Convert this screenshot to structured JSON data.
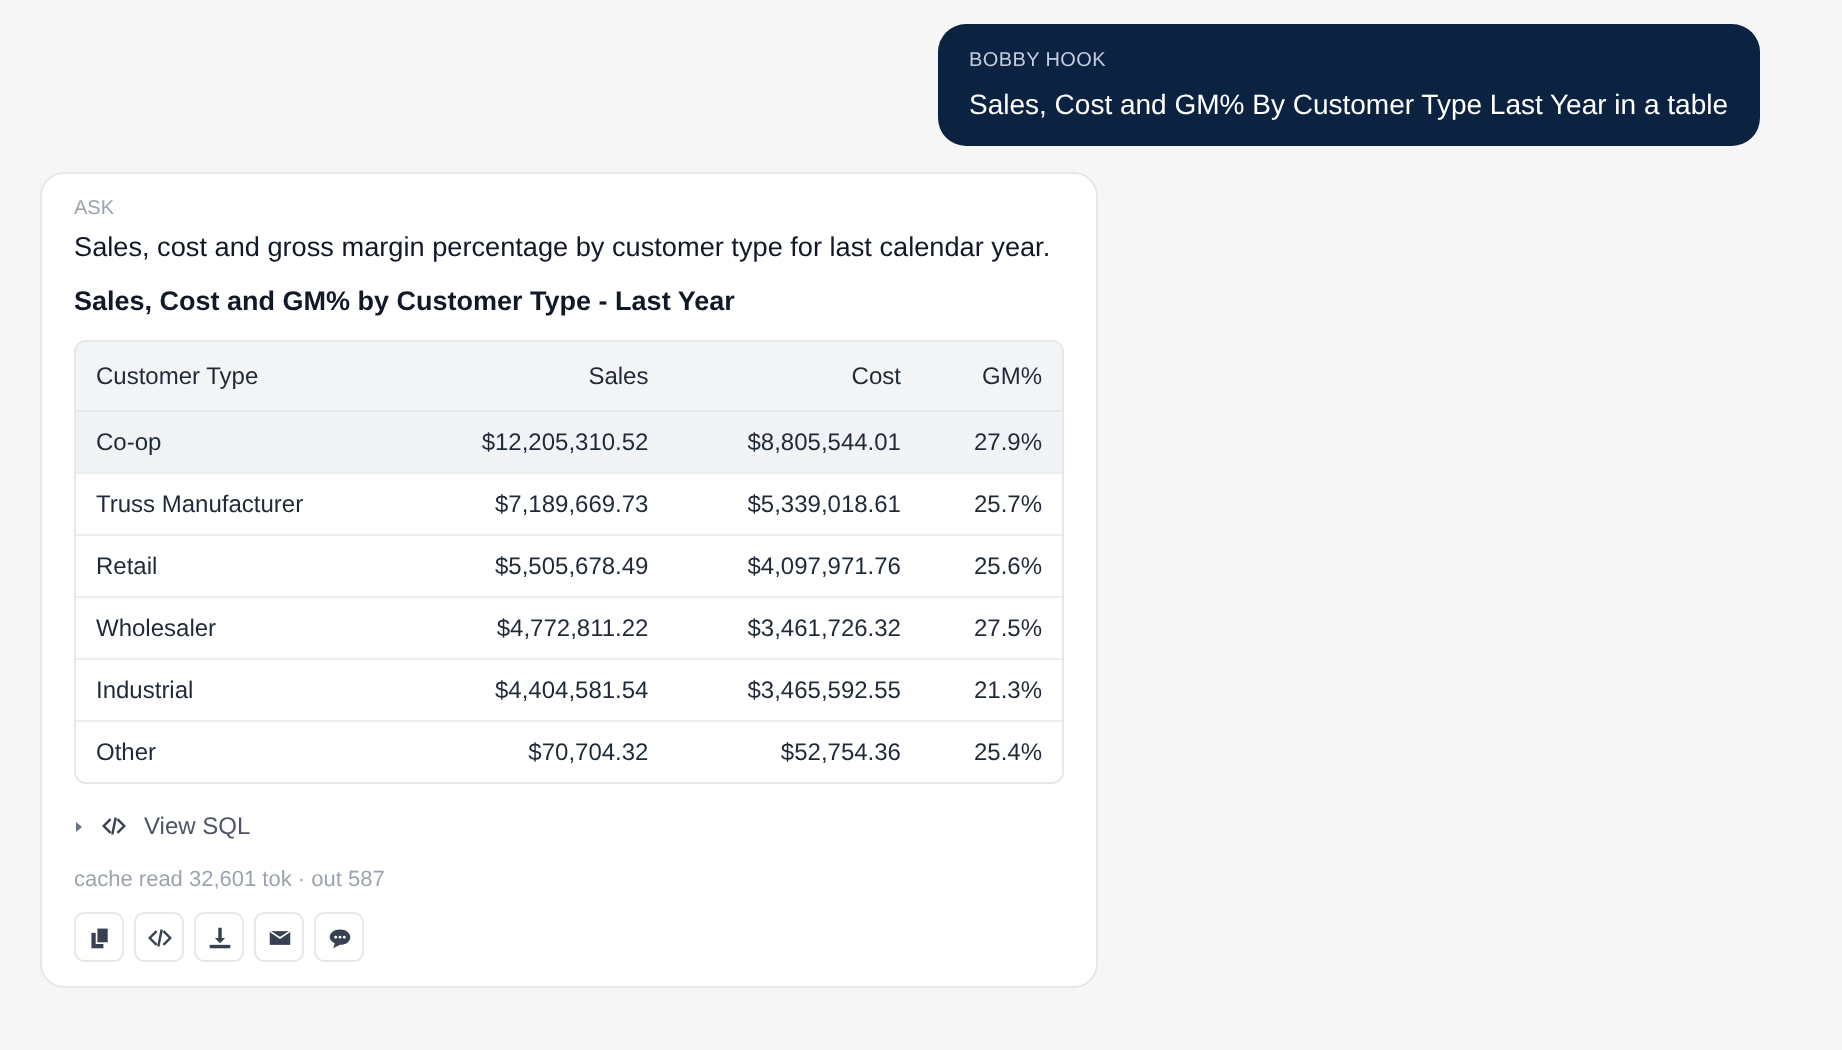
{
  "user_message": {
    "author": "BOBBY HOOK",
    "text": "Sales, Cost and GM% By Customer Type Last Year in a table"
  },
  "answer": {
    "label": "ASK",
    "question": "Sales, cost and gross margin percentage by customer type for last calendar year.",
    "table_title": "Sales, Cost and GM% by Customer Type - Last Year",
    "table": {
      "columns": [
        "Customer Type",
        "Sales",
        "Cost",
        "GM%"
      ],
      "rows": [
        {
          "cells": [
            "Co-op",
            "$12,205,310.52",
            "$8,805,544.01",
            "27.9%"
          ],
          "highlighted": true
        },
        {
          "cells": [
            "Truss Manufacturer",
            "$7,189,669.73",
            "$5,339,018.61",
            "25.7%"
          ],
          "highlighted": false
        },
        {
          "cells": [
            "Retail",
            "$5,505,678.49",
            "$4,097,971.76",
            "25.6%"
          ],
          "highlighted": false
        },
        {
          "cells": [
            "Wholesaler",
            "$4,772,811.22",
            "$3,461,726.32",
            "27.5%"
          ],
          "highlighted": false
        },
        {
          "cells": [
            "Industrial",
            "$4,404,581.54",
            "$3,465,592.55",
            "21.3%"
          ],
          "highlighted": false
        },
        {
          "cells": [
            "Other",
            "$70,704.32",
            "$52,754.36",
            "25.4%"
          ],
          "highlighted": false
        }
      ]
    },
    "sql_toggle": {
      "label": "View SQL",
      "expanded": false
    },
    "usage": "cache read 32,601 tok · out 587",
    "actions": [
      {
        "kind": "copy"
      },
      {
        "kind": "code"
      },
      {
        "kind": "download"
      },
      {
        "kind": "email"
      },
      {
        "kind": "chat"
      }
    ]
  }
}
